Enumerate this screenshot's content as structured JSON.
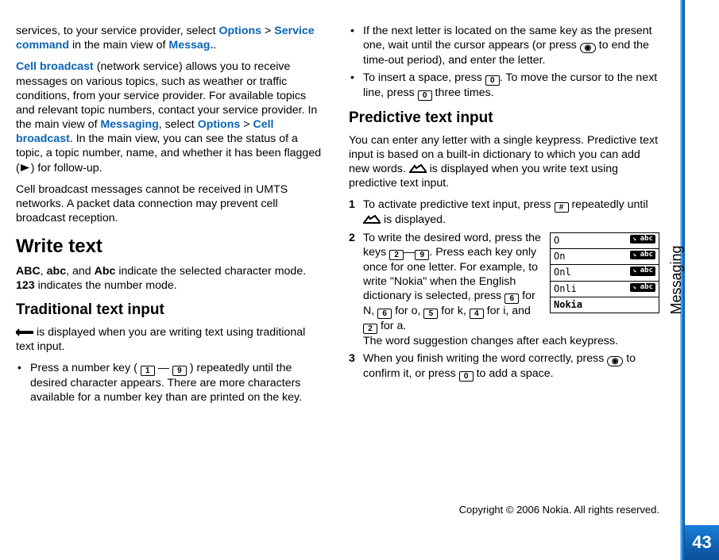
{
  "side_label": "Messaging",
  "page_number": "43",
  "footer": "Copyright © 2006 Nokia. All rights reserved.",
  "col1": {
    "p1_a": "services, to your service provider, select ",
    "p1_opt": "Options",
    "p1_gt": " > ",
    "p1_sc": "Service command",
    "p1_b": " in the main view of ",
    "p1_msg": "Messag.",
    "p1_c": ".",
    "p2_cb": "Cell broadcast",
    "p2_a": " (network service) allows you to receive messages on various topics, such as weather or traffic conditions, from your service provider. For available topics and relevant topic numbers, contact your service provider. In the main view of ",
    "p2_msg": "Messaging",
    "p2_b": ", select ",
    "p2_opt": "Options",
    "p2_gt": " > ",
    "p2_cb2": "Cell broadcast",
    "p2_c": ". In the main view, you can see the status of a topic, a topic number, name, and whether it has been flagged (",
    "p2_d": ") for follow-up.",
    "p3": "Cell broadcast messages cannot be received in UMTS networks. A packet data connection may prevent cell broadcast reception.",
    "h1": "Write text",
    "p4_abc1": "ABC",
    "p4_a": ", ",
    "p4_abc2": "abc",
    "p4_b": ", and ",
    "p4_abc3": "Abc",
    "p4_c": " indicate the selected character mode. ",
    "p4_123": "123",
    "p4_d": " indicates the number mode.",
    "h2": "Traditional text input",
    "p5": " is displayed when you are writing text using traditional text input.",
    "b1_a": "Press a number key (",
    "b1_b": "—",
    "b1_c": ") repeatedly until the desired character appears. There are more characters available for a number key than are printed on the key."
  },
  "col2": {
    "b2": "If the next letter is located on the same key as the present one, wait until the cursor appears (or press ",
    "b2_b": " to end the time-out period), and enter the letter.",
    "b3_a": "To insert a space, press ",
    "b3_b": ". To move the cursor to the next line, press ",
    "b3_c": " three times.",
    "h2": "Predictive text input",
    "p1_a": "You can enter any letter with a single keypress. Predictive text input is based on a built-in dictionary to which you can add new words. ",
    "p1_b": " is displayed when you write text using predictive text input.",
    "s1_a": "To activate predictive text input, press ",
    "s1_b": " repeatedly until ",
    "s1_c": " is displayed.",
    "s2_a": "To write the desired word, press the keys ",
    "s2_dash": "—",
    "s2_b": ". Press each key only once for one letter. For example, to write \"Nokia\" when the English dictionary is selected, press ",
    "s2_c": " for N, ",
    "s2_d": " for o, ",
    "s2_e": " for k, ",
    "s2_f": " for i, and ",
    "s2_g": " for a.",
    "s2_h": "The word suggestion changes after each keypress.",
    "s3_a": "When you finish writing the word correctly, press ",
    "s3_b": " to confirm it, or press ",
    "s3_c": " to add a space."
  },
  "keys": {
    "k1": "1",
    "k2": "2",
    "k4": "4",
    "k5": "5",
    "k6": "6",
    "k9": "9",
    "k0": "0",
    "hash": "#"
  },
  "figure": {
    "rows": [
      "O",
      "On",
      "Onl",
      "Onli",
      "Nokia"
    ],
    "badge": "abc"
  }
}
